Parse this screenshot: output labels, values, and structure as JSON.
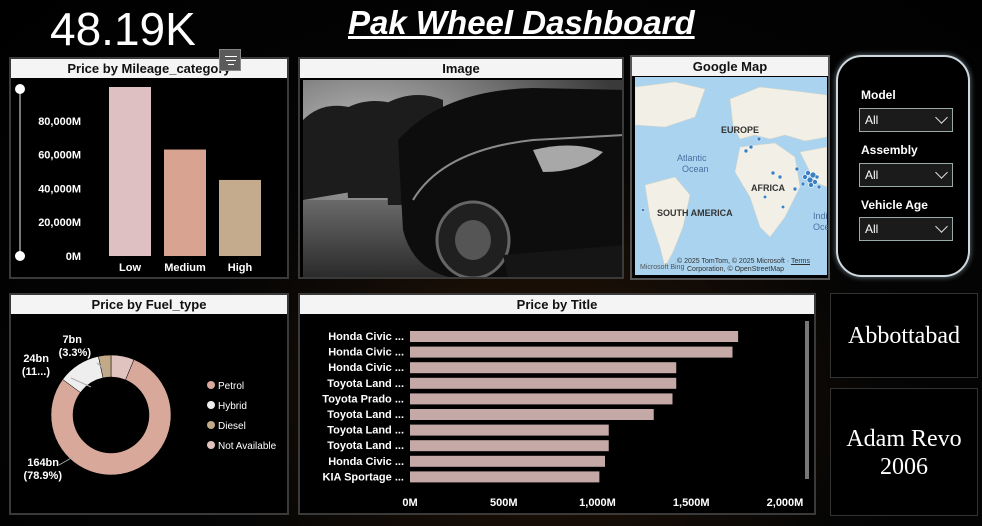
{
  "kpi": {
    "value": "48.19K"
  },
  "dashboard": {
    "title": "Pak Wheel Dashboard"
  },
  "mileage_chart": {
    "title": "Price by Mileage_category",
    "y_ticks": [
      "80,000M",
      "60,000M",
      "40,000M",
      "20,000M",
      "0M"
    ]
  },
  "image_panel": {
    "title": "Image"
  },
  "map_panel": {
    "title": "Google Map",
    "labels": {
      "europe": "EUROPE",
      "atlantic": "Atlantic",
      "ocean": "Ocean",
      "africa": "AFRICA",
      "south_america": "SOUTH AMERICA",
      "indian": "India",
      "indian2": "Oce"
    },
    "attribution_1": "© 2025 TomTom, © 2025 Microsoft",
    "attribution_terms": "Terms",
    "attribution_2": "Corporation, © OpenStreetMap",
    "bing": "Microsoft Bing"
  },
  "filters": {
    "model_label": "Model",
    "model_value": "All",
    "assembly_label": "Assembly",
    "assembly_value": "All",
    "vehicle_age_label": "Vehicle Age",
    "vehicle_age_value": "All"
  },
  "fuel_chart": {
    "title": "Price by Fuel_type",
    "legend": [
      "Petrol",
      "Hybrid",
      "Diesel",
      "Not Available"
    ],
    "labels": {
      "petrol_value": "164bn",
      "petrol_pct": "(78.9%)",
      "hybrid_value": "24bn",
      "hybrid_pct": "(11...)",
      "diesel_value": "7bn",
      "diesel_pct": "(3.3%)"
    }
  },
  "title_chart": {
    "title": "Price by Title",
    "x_ticks": [
      "0M",
      "500M",
      "1,000M",
      "1,500M",
      "2,000M"
    ]
  },
  "cards": {
    "city": "Abbottabad",
    "car_line1": "Adam Revo",
    "car_line2": "2006"
  },
  "colors": {
    "low": "#dfc0c2",
    "medium": "#d8a391",
    "high": "#c4ab8d",
    "petrol": "#d8a89a",
    "hybrid": "#eeeeee",
    "diesel": "#c2a988",
    "not_available": "#e0c3bf",
    "title_bar": "#c4a9a7"
  },
  "chart_data": [
    {
      "type": "bar",
      "title": "Price by Mileage_category",
      "categories": [
        "Low",
        "Medium",
        "High"
      ],
      "values": [
        100000,
        63000,
        45000
      ],
      "ylim": [
        0,
        100000
      ],
      "ylabel_unit": "M"
    },
    {
      "type": "pie",
      "title": "Price by Fuel_type",
      "categories": [
        "Petrol",
        "Hybrid",
        "Diesel",
        "Not Available"
      ],
      "values": [
        164,
        24,
        7,
        13
      ],
      "units": "bn"
    },
    {
      "type": "bar",
      "orientation": "horizontal",
      "title": "Price by Title",
      "categories": [
        "Honda Civic ...",
        "Honda Civic ...",
        "Honda Civic ...",
        "Toyota Land ...",
        "Toyota Prado ...",
        "Toyota Land ...",
        "Toyota Land ...",
        "Toyota Land ...",
        "Honda Civic ...",
        "KIA Sportage ..."
      ],
      "values": [
        1750,
        1720,
        1420,
        1420,
        1400,
        1300,
        1060,
        1060,
        1040,
        1010
      ],
      "xlim": [
        0,
        2000
      ],
      "units": "M"
    }
  ]
}
